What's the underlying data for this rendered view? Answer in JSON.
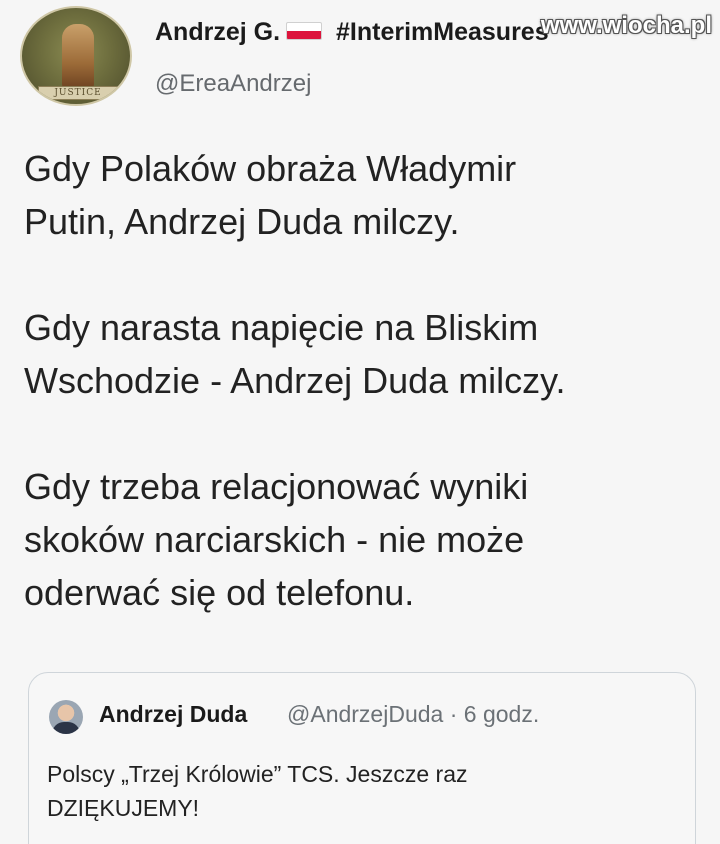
{
  "author": {
    "display_name": "Andrzej G.",
    "hashtag": "#InterimMeasures",
    "handle": "@EreaAndrzej",
    "avatar_banner": "JUSTICE"
  },
  "watermark": "www.wiocha.pl",
  "tweet": {
    "paragraphs": [
      [
        "Gdy Polaków obraża Władymir",
        "Putin, Andrzej Duda milczy."
      ],
      [
        "Gdy narasta napięcie na Bliskim",
        "Wschodzie - Andrzej Duda milczy."
      ],
      [
        "Gdy trzeba relacjonować wyniki",
        "skoków narciarskich - nie może",
        "oderwać się od telefonu."
      ]
    ]
  },
  "quoted": {
    "name": "Andrzej Duda",
    "handle": "@AndrzejDuda",
    "time": "· 6 godz.",
    "text": [
      "Polscy „Trzej Królowie” TCS. Jeszcze raz",
      "DZIĘKUJEMY!"
    ]
  }
}
